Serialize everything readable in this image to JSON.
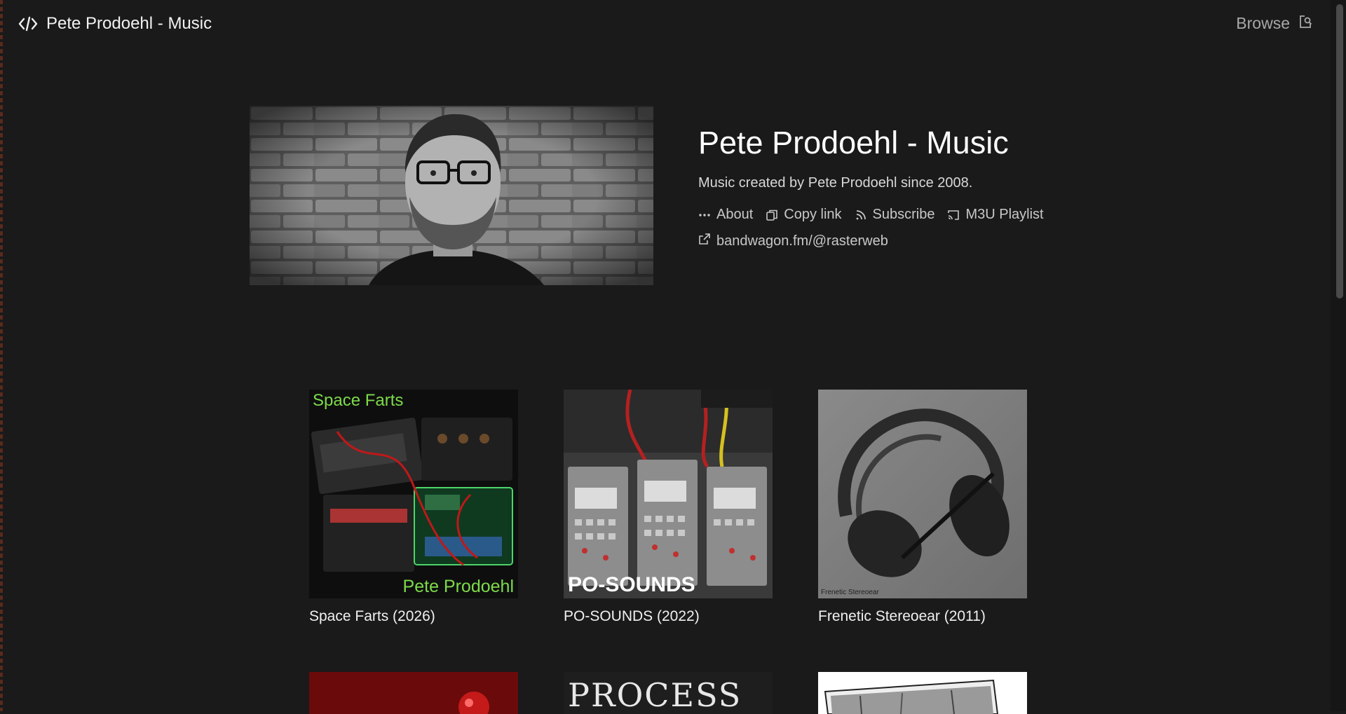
{
  "header": {
    "title": "Pete Prodoehl - Music",
    "browse_label": "Browse"
  },
  "profile": {
    "title": "Pete Prodoehl - Music",
    "description": "Music created by Pete Prodoehl since 2008.",
    "actions": [
      {
        "label": "About",
        "icon": "more-dots-icon"
      },
      {
        "label": "Copy link",
        "icon": "copy-icon"
      },
      {
        "label": "Subscribe",
        "icon": "rss-icon"
      },
      {
        "label": "M3U Playlist",
        "icon": "cast-icon"
      }
    ],
    "external_link": "bandwagon.fm/@rasterweb"
  },
  "releases": [
    {
      "title": "Space Farts (2026)",
      "cover_text_top": "Space Farts",
      "cover_text_bottom": "Pete Prodoehl"
    },
    {
      "title": "PO-SOUNDS (2022)",
      "cover_text_bottom": "PO-SOUNDS"
    },
    {
      "title": "Frenetic Stereoear (2011)",
      "cover_text_bottom": "Frenetic Stereoear"
    }
  ],
  "partial_releases": [
    {
      "cover_text": ""
    },
    {
      "cover_text": "PROCESS"
    },
    {
      "cover_text": ""
    }
  ],
  "colors": {
    "background": "#1a1a1a",
    "text": "#ffffff",
    "muted": "#c8c8c8",
    "space_farts_green": "#7ddb4a"
  }
}
